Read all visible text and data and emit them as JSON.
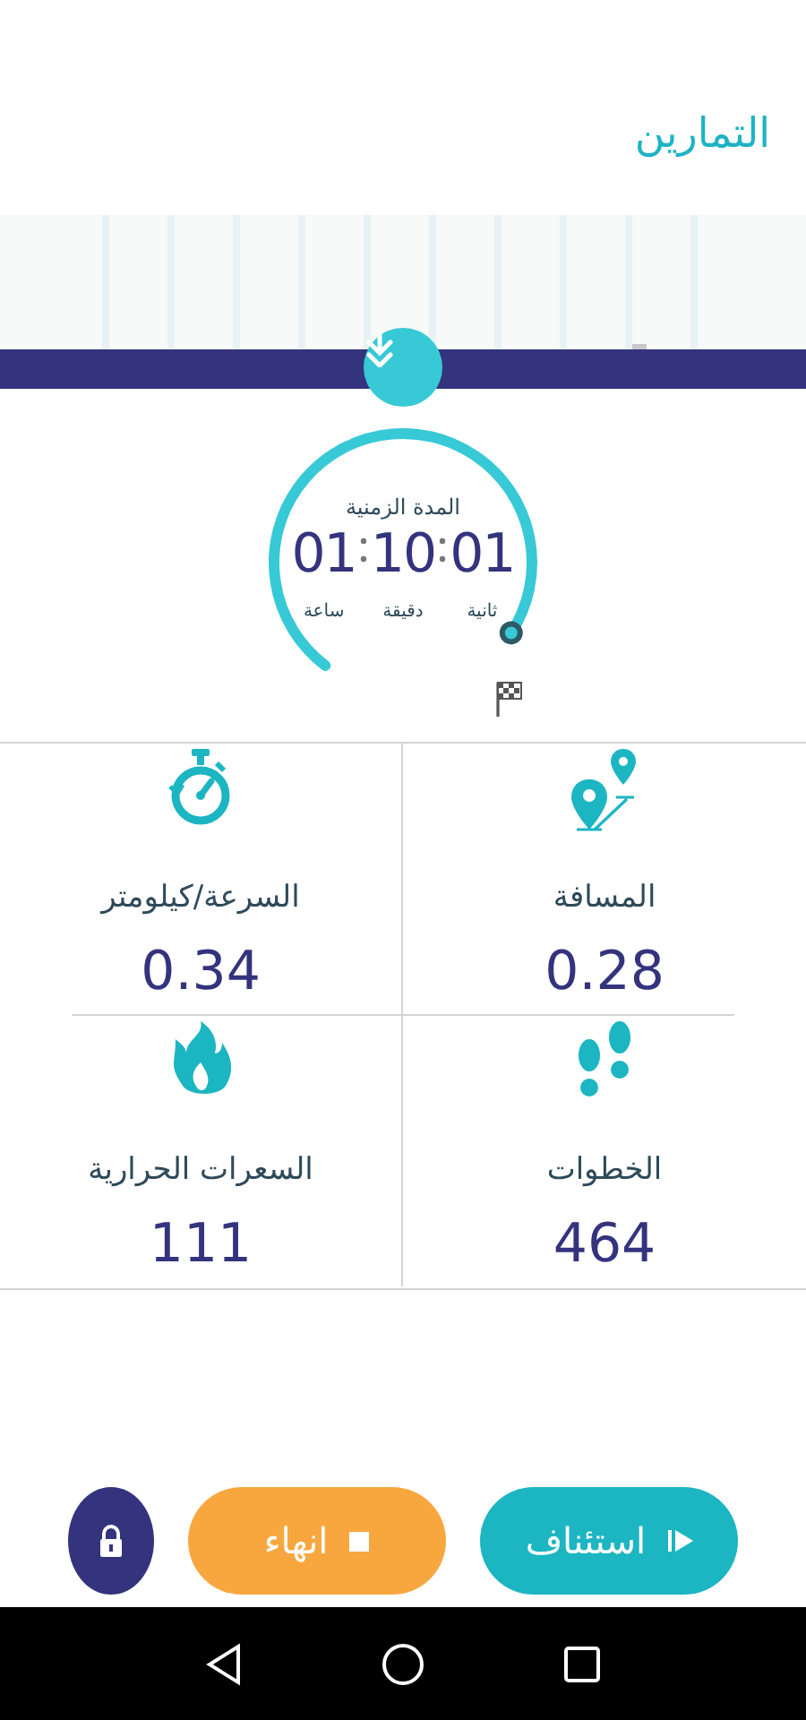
{
  "header": {
    "title": "التمارين"
  },
  "timer": {
    "title": "المدة الزمنية",
    "segments": [
      {
        "value": "01",
        "unit": "ثانية"
      },
      {
        "value": "10",
        "unit": "دقيقة"
      },
      {
        "value": "01",
        "unit": "ساعة"
      }
    ]
  },
  "stats": [
    {
      "kind": "distance",
      "label": "المسافة",
      "value": "0.28"
    },
    {
      "kind": "speed",
      "label": "السرعة/كيلومتر",
      "value": "0.34"
    },
    {
      "kind": "steps",
      "label": "الخطوات",
      "value": "464"
    },
    {
      "kind": "calories",
      "label": "السعرات الحرارية",
      "value": "111"
    }
  ],
  "actions": [
    {
      "kind": "resume",
      "label": "استئناف"
    },
    {
      "kind": "finish",
      "label": "انهاء"
    },
    {
      "kind": "lock"
    }
  ]
}
